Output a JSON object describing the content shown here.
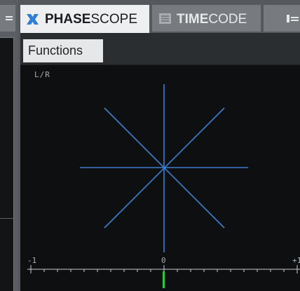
{
  "tabs": {
    "active": {
      "label_strong": "PHASE",
      "label_rest": "SCOPE",
      "icon": "phasescope-icon"
    },
    "inactive": {
      "label_strong": "TIME",
      "label_rest": "CODE",
      "icon": "timecode-icon"
    },
    "partial": {
      "icon": "level-meter-icon"
    }
  },
  "left_panel": {
    "icon": "menu-icon"
  },
  "toolbar": {
    "functions_label": "Functions"
  },
  "scope": {
    "channel_label": "L/R",
    "scale_ticks": [
      "-1",
      "0",
      "+1"
    ],
    "colors": {
      "trace": "#3c7fd0",
      "scale": "#c9ccd0",
      "correlation_marker": "#27c93f",
      "background": "#0d0f10"
    }
  }
}
